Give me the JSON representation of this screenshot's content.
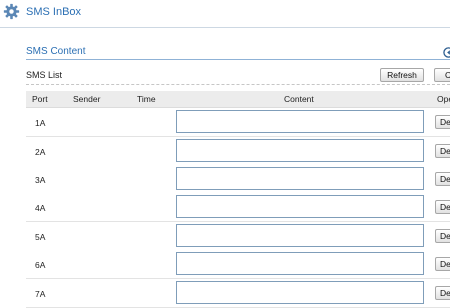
{
  "header": {
    "title": "SMS InBox",
    "icon": "gear-icon"
  },
  "section": {
    "title": "SMS Content",
    "collapse_icon": "collapse-icon"
  },
  "list": {
    "label": "SMS List",
    "refresh_label": "Refresh",
    "other_button_label": "C"
  },
  "table": {
    "columns": [
      "Port",
      "Sender",
      "Time",
      "Content",
      "Ope"
    ],
    "rows": [
      {
        "port": "1A",
        "sender": "",
        "time": "",
        "content": "",
        "action": "De"
      },
      {
        "port": "2A",
        "sender": "",
        "time": "",
        "content": "",
        "action": "De"
      },
      {
        "port": "3A",
        "sender": "",
        "time": "",
        "content": "",
        "action": "De"
      },
      {
        "port": "4A",
        "sender": "",
        "time": "",
        "content": "",
        "action": "De"
      },
      {
        "port": "5A",
        "sender": "",
        "time": "",
        "content": "",
        "action": "De"
      },
      {
        "port": "6A",
        "sender": "",
        "time": "",
        "content": "",
        "action": "De"
      },
      {
        "port": "7A",
        "sender": "",
        "time": "",
        "content": "",
        "action": "De"
      }
    ]
  },
  "colors": {
    "accent": "#2b6fb3",
    "header_row": "#ececec",
    "input_border": "#7f9db9"
  }
}
